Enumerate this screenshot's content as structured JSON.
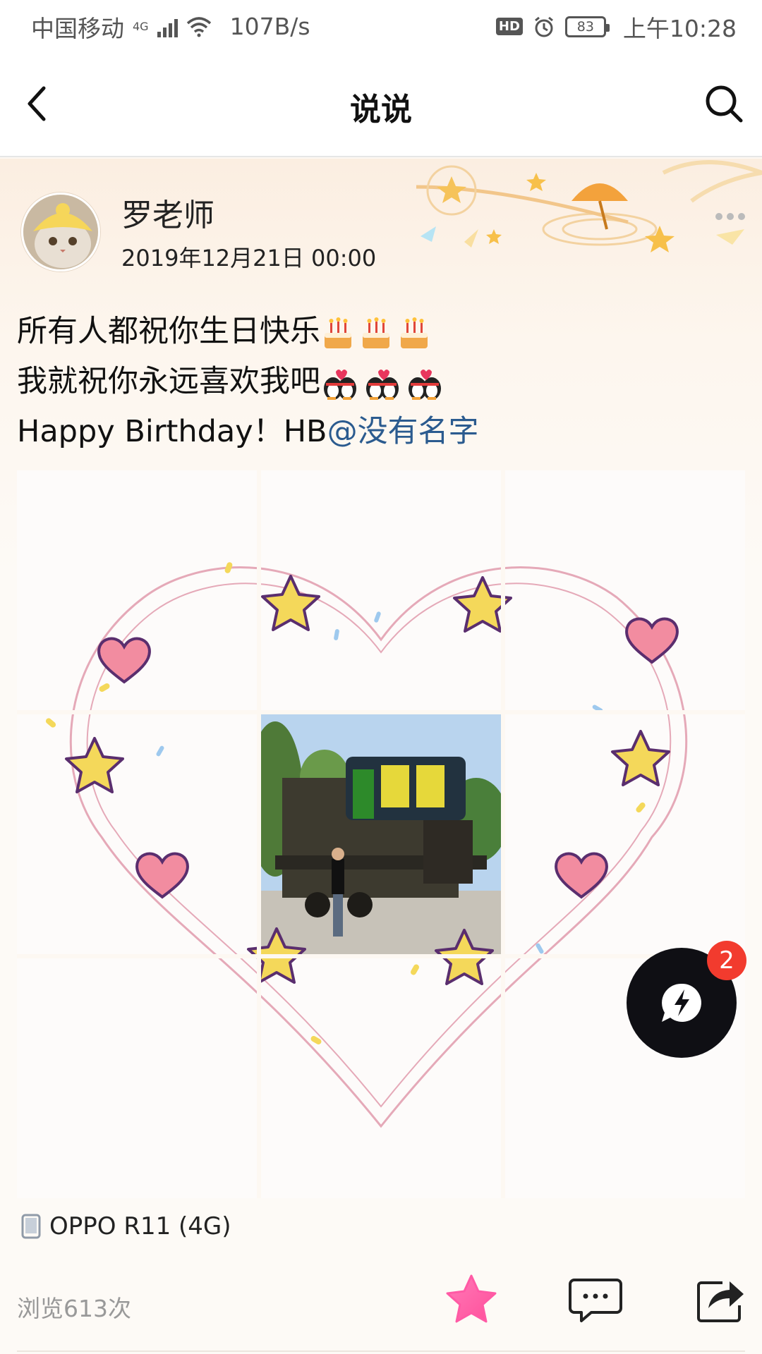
{
  "status_bar": {
    "carrier": "中国移动",
    "network": "4G",
    "speed": "107B/s",
    "hd": "HD",
    "battery": "83",
    "time": "上午10:28"
  },
  "header": {
    "title": "说说",
    "back_icon": "chevron-left-icon",
    "search_icon": "search-icon"
  },
  "post": {
    "author": "罗老师",
    "time": "2019年12月21日 00:00",
    "lines": [
      {
        "text": "所有人都祝你生日快乐",
        "emoji": [
          "birthday-cake",
          "birthday-cake",
          "birthday-cake"
        ]
      },
      {
        "text": "我就祝你永远喜欢我吧",
        "emoji": [
          "penguin-couple",
          "penguin-couple",
          "penguin-couple"
        ]
      }
    ],
    "line3_text": "Happy Birthday！HB",
    "mention": "@没有名字",
    "device": "OPPO R11 (4G)",
    "views": "浏览613次"
  },
  "fab": {
    "badge": "2",
    "icon": "lightning-chat-icon"
  },
  "colors": {
    "mention": "#2b5b8f",
    "like": "#ff5aa5",
    "badge": "#f23b2e"
  }
}
